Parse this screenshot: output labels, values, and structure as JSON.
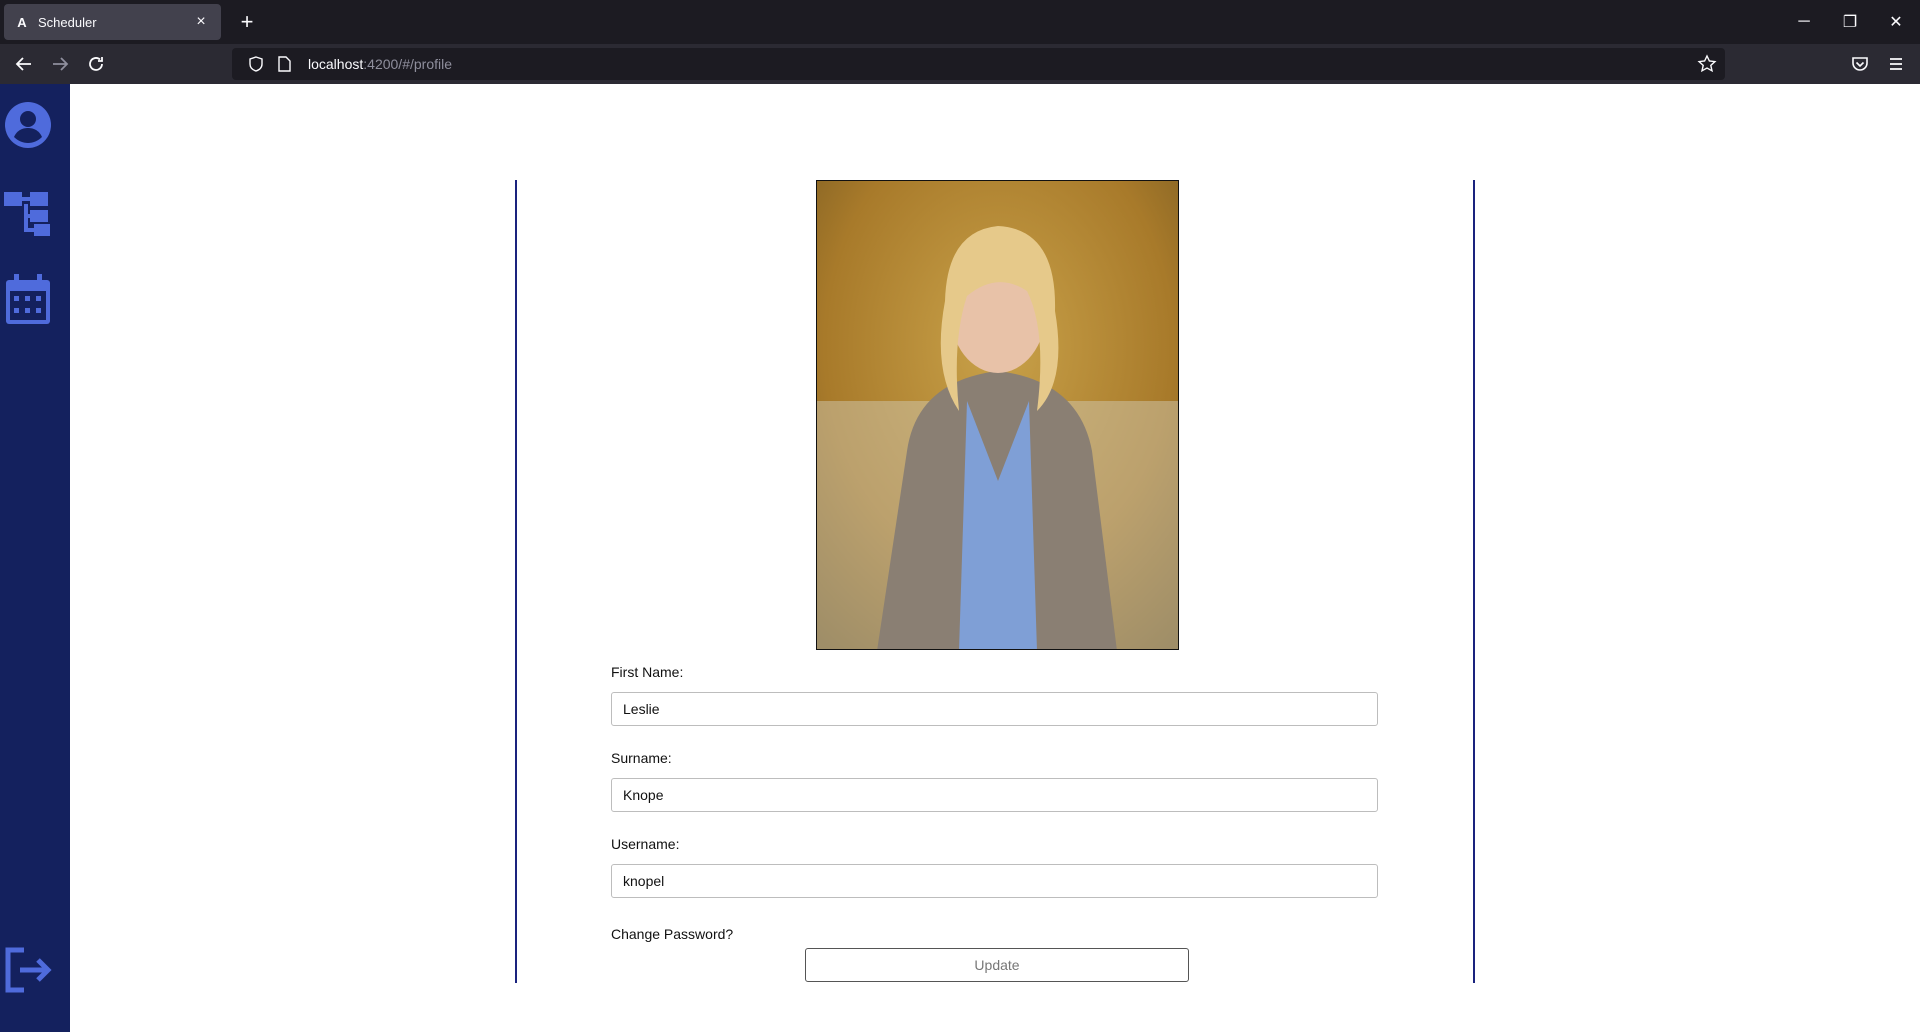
{
  "browser": {
    "tab_title": "Scheduler",
    "tab_favicon": "A",
    "new_tab_symbol": "+",
    "url_host": "localhost",
    "url_path": ":4200/#/profile",
    "minimize_symbol": "─",
    "restore_symbol": "❐",
    "close_symbol": "✕"
  },
  "sidebar": {
    "items": [
      {
        "icon": "account-circle-icon"
      },
      {
        "icon": "hierarchy-icon"
      },
      {
        "icon": "calendar-icon"
      }
    ],
    "logout_icon": "logout-icon"
  },
  "profile": {
    "photo_alt": "profile-photo",
    "first_name_label": "First Name:",
    "first_name_value": "Leslie",
    "surname_label": "Surname:",
    "surname_value": "Knope",
    "username_label": "Username:",
    "username_value": "knopel",
    "change_password_label": "Change Password?",
    "update_label": "Update"
  },
  "colors": {
    "sidebar_bg": "#14215e",
    "sidebar_icon": "#4f6bdc",
    "card_border": "#1a237e"
  }
}
